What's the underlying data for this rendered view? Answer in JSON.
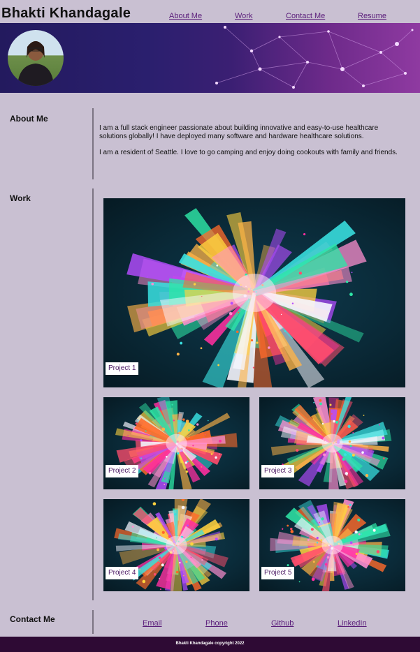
{
  "header": {
    "site_name": "Bhakti Khandagale",
    "nav": [
      "About Me",
      "Work",
      "Contact Me",
      "Resume"
    ]
  },
  "about": {
    "heading": "About Me",
    "paragraph1": "I am a full stack engineer passionate about building innovative and easy-to-use healthcare solutions globally! I have deployed many software and hardware healthcare solutions.",
    "paragraph2": "I am a resident of Seattle. I love to go camping and enjoy doing cookouts with family and friends."
  },
  "work": {
    "heading": "Work",
    "projects": [
      "Project 1",
      "Project 2",
      "Project 3",
      "Project 4",
      "Project 5"
    ]
  },
  "contact": {
    "heading": "Contact Me",
    "links": [
      "Email",
      "Phone",
      "Github",
      "LinkedIn"
    ]
  },
  "footer": {
    "copyright": "Bhakti Khandagale copyright 2022"
  },
  "colors": {
    "background": "#c9c0d2",
    "link": "#5a1d7a",
    "footer": "#2e0a34"
  }
}
